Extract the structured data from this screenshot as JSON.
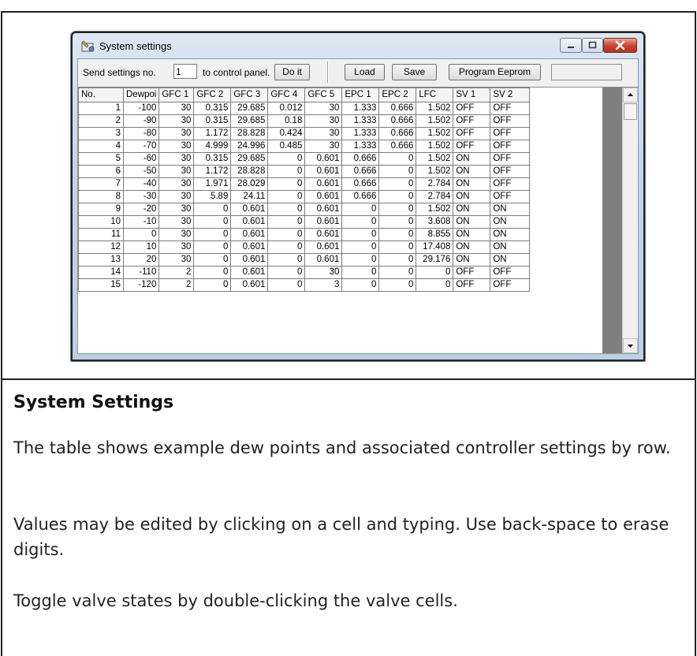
{
  "window": {
    "title": "System settings"
  },
  "toolbar": {
    "send_label": "Send settings no.",
    "send_value": "1",
    "to_label": "to control panel.",
    "doit_label": "Do it",
    "load_label": "Load",
    "save_label": "Save",
    "program_label": "Program Eeprom"
  },
  "table": {
    "headers": [
      "No.",
      "Dewpoi",
      "GFC 1",
      "GFC 2",
      "GFC 3",
      "GFC 4",
      "GFC 5",
      "EPC 1",
      "EPC 2",
      "LFC",
      "SV 1",
      "SV 2"
    ],
    "rows": [
      [
        "1",
        "-100",
        "30",
        "0.315",
        "29.685",
        "0.012",
        "30",
        "1.333",
        "0.666",
        "1.502",
        "OFF",
        "OFF"
      ],
      [
        "2",
        "-90",
        "30",
        "0.315",
        "29.685",
        "0.18",
        "30",
        "1.333",
        "0.666",
        "1.502",
        "OFF",
        "OFF"
      ],
      [
        "3",
        "-80",
        "30",
        "1.172",
        "28.828",
        "0.424",
        "30",
        "1.333",
        "0.666",
        "1.502",
        "OFF",
        "OFF"
      ],
      [
        "4",
        "-70",
        "30",
        "4.999",
        "24.996",
        "0.485",
        "30",
        "1.333",
        "0.666",
        "1.502",
        "OFF",
        "OFF"
      ],
      [
        "5",
        "-60",
        "30",
        "0.315",
        "29.685",
        "0",
        "0.601",
        "0.666",
        "0",
        "1.502",
        "ON",
        "OFF"
      ],
      [
        "6",
        "-50",
        "30",
        "1.172",
        "28.828",
        "0",
        "0.601",
        "0.666",
        "0",
        "1.502",
        "ON",
        "OFF"
      ],
      [
        "7",
        "-40",
        "30",
        "1.971",
        "28.029",
        "0",
        "0.601",
        "0.666",
        "0",
        "2.784",
        "ON",
        "OFF"
      ],
      [
        "8",
        "-30",
        "30",
        "5.89",
        "24.11",
        "0",
        "0.601",
        "0.666",
        "0",
        "2.784",
        "ON",
        "OFF"
      ],
      [
        "9",
        "-20",
        "30",
        "0",
        "0.601",
        "0",
        "0.601",
        "0",
        "0",
        "1.502",
        "ON",
        "ON"
      ],
      [
        "10",
        "-10",
        "30",
        "0",
        "0.601",
        "0",
        "0.601",
        "0",
        "0",
        "3.608",
        "ON",
        "ON"
      ],
      [
        "11",
        "0",
        "30",
        "0",
        "0.601",
        "0",
        "0.601",
        "0",
        "0",
        "8.855",
        "ON",
        "ON"
      ],
      [
        "12",
        "10",
        "30",
        "0",
        "0.601",
        "0",
        "0.601",
        "0",
        "0",
        "17.408",
        "ON",
        "ON"
      ],
      [
        "13",
        "20",
        "30",
        "0",
        "0.601",
        "0",
        "0.601",
        "0",
        "0",
        "29.176",
        "ON",
        "ON"
      ],
      [
        "14",
        "-110",
        "2",
        "0",
        "0.601",
        "0",
        "30",
        "0",
        "0",
        "0",
        "OFF",
        "OFF"
      ],
      [
        "15",
        "-120",
        "2",
        "0",
        "0.601",
        "0",
        "3",
        "0",
        "0",
        "0",
        "OFF",
        "OFF"
      ]
    ]
  },
  "help": {
    "heading": "System Settings",
    "para1": "The table shows example dew points and associated controller settings by row.",
    "para2": "Values may be edited by clicking on a cell and typing. Use back-space to erase digits.",
    "para3": "Toggle valve states by double-clicking the valve cells."
  },
  "icons": {
    "app": "settings-app-icon",
    "minimize": "minimize-icon",
    "maximize": "maximize-icon",
    "close": "close-icon",
    "scroll_up": "arrow-up-icon",
    "scroll_down": "arrow-down-icon"
  },
  "colors": {
    "close_button": "#c7422d",
    "window_frame": "#c9d8ea",
    "grid_filler": "#7f7f7f"
  }
}
